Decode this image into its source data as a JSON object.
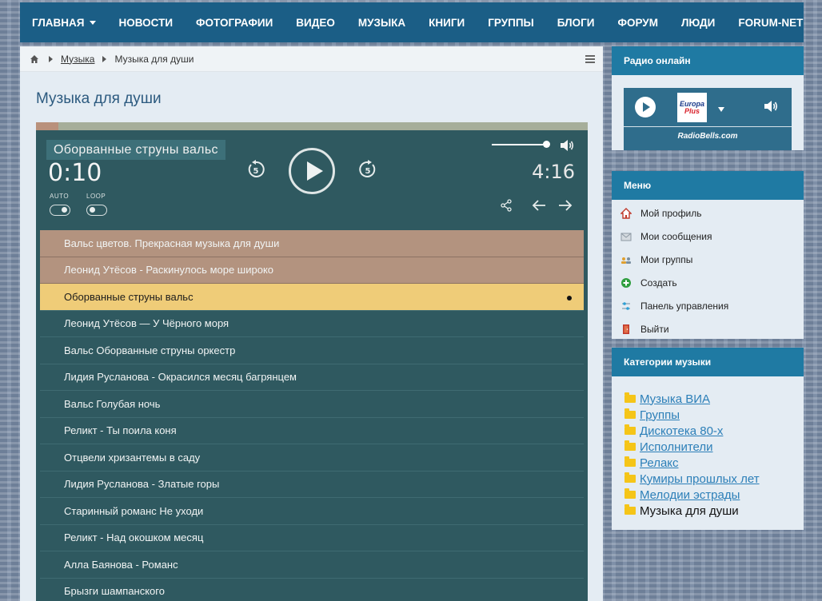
{
  "nav": {
    "items": [
      "ГЛАВНАЯ",
      "НОВОСТИ",
      "ФОТОГРАФИИ",
      "ВИДЕО",
      "МУЗЫКА",
      "КНИГИ",
      "ГРУППЫ",
      "БЛОГИ",
      "ФОРУМ",
      "ЛЮДИ",
      "FORUM-NET"
    ]
  },
  "breadcrumb": {
    "parent": "Музыка",
    "current": "Музыка для души"
  },
  "page": {
    "title": "Музыка для души"
  },
  "player": {
    "track_title": "Оборванные струны вальс",
    "current_time": "0:10",
    "duration": "4:16",
    "progress": 0.04,
    "volume": 0.95,
    "auto_label": "AUTO",
    "loop_label": "LOOP",
    "skip_seconds": "5",
    "playlist": [
      {
        "title": "Вальс цветов. Прекрасная музыка для души",
        "state": "played"
      },
      {
        "title": "Леонид Утёсов - Раскинулось море широко",
        "state": "played"
      },
      {
        "title": "Оборванные струны вальс",
        "state": "active"
      },
      {
        "title": "Леонид Утёсов — У Чёрного моря",
        "state": ""
      },
      {
        "title": "Вальс Оборванные струны оркестр",
        "state": ""
      },
      {
        "title": "Лидия Русланова - Окрасился месяц багрянцем",
        "state": ""
      },
      {
        "title": "Вальс Голубая ночь",
        "state": ""
      },
      {
        "title": "Реликт - Ты поила коня",
        "state": ""
      },
      {
        "title": "Отцвели хризантемы в саду",
        "state": ""
      },
      {
        "title": "Лидия Русланова - Златые горы",
        "state": ""
      },
      {
        "title": "Старинный романс Не уходи",
        "state": ""
      },
      {
        "title": "Реликт - Над окошком месяц",
        "state": ""
      },
      {
        "title": "Алла Баянова - Романс",
        "state": ""
      },
      {
        "title": "Брызги шампанского",
        "state": ""
      }
    ]
  },
  "radio": {
    "title": "Радио онлайн",
    "station_line1": "Europa",
    "station_line2": "Plus",
    "site": "RadioBells.com"
  },
  "menu": {
    "title": "Меню",
    "items": [
      {
        "label": "Мой профиль",
        "icon": "home-icon"
      },
      {
        "label": "Мои сообщения",
        "icon": "envelope-icon"
      },
      {
        "label": "Мои группы",
        "icon": "group-icon"
      },
      {
        "label": "Создать",
        "icon": "plus-icon"
      },
      {
        "label": "Панель управления",
        "icon": "sliders-icon"
      },
      {
        "label": "Выйти",
        "icon": "exit-door-icon"
      }
    ]
  },
  "categories": {
    "title": "Категории музыки",
    "items": [
      {
        "label": "Музыка ВИА",
        "current": false
      },
      {
        "label": "Группы",
        "current": false
      },
      {
        "label": "Дискотека 80-х",
        "current": false
      },
      {
        "label": "Исполнители",
        "current": false
      },
      {
        "label": "Релакс",
        "current": false
      },
      {
        "label": "Кумиры прошлых лет",
        "current": false
      },
      {
        "label": "Мелодии эстрады",
        "current": false
      },
      {
        "label": "Музыка для души",
        "current": true
      }
    ]
  },
  "colors": {
    "nav_bg": "#1b5e86",
    "widget_head": "#1f7aa3",
    "player_bg": "#2f5960",
    "played_row": "#b3937f",
    "active_row": "#efcc78"
  }
}
